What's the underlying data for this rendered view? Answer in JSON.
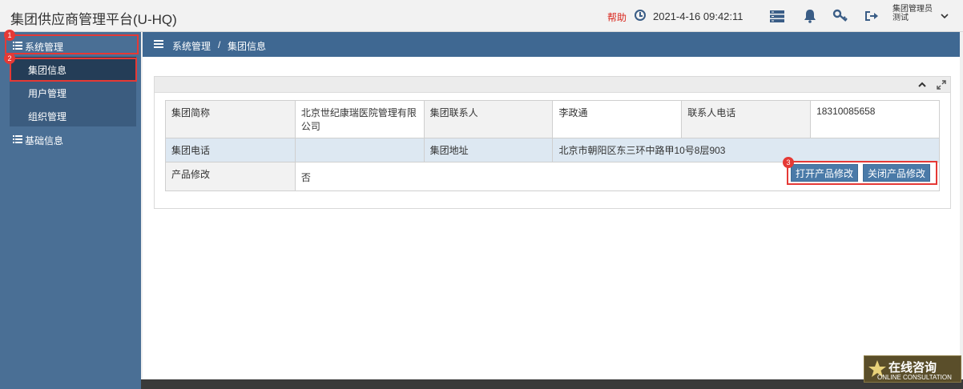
{
  "header": {
    "app_title": "集团供应商管理平台(U-HQ)",
    "help_label": "帮助",
    "datetime": "2021-4-16  09:42:11",
    "user_name_line1": "集团管理员",
    "user_name_line2": "测试",
    "icons": [
      "clock-icon",
      "server-icon",
      "bell-icon",
      "key-icon",
      "logout-icon",
      "chevron-down-icon"
    ]
  },
  "sidebar": {
    "system_mgmt": "系统管理",
    "sub_items": [
      {
        "label": "集团信息"
      },
      {
        "label": "用户管理"
      },
      {
        "label": "组织管理"
      }
    ],
    "basic_info": "基础信息"
  },
  "breadcrumb": {
    "level1": "系统管理",
    "separator": "/",
    "level2": "集团信息"
  },
  "info": {
    "rows": [
      {
        "k1": "集团简称",
        "v1": "北京世纪康瑞医院管理有限公司",
        "k2": "集团联系人",
        "v2": "李政通",
        "k3": "联系人电话",
        "v3": "18310085658"
      },
      {
        "k1": "集团电话",
        "v1": "",
        "k2": "集团地址",
        "v2": "北京市朝阳区东三环中路甲10号8层903"
      },
      {
        "k1": "产品修改",
        "v1": "否"
      }
    ]
  },
  "actions": {
    "open_product_edit": "打开产品修改",
    "close_product_edit": "关闭产品修改"
  },
  "annotations": {
    "badge1": "1",
    "badge2": "2",
    "badge3": "3"
  },
  "consult": {
    "title": "在线咨询",
    "subtitle": "ONLINE CONSULTATION"
  },
  "colors": {
    "sidebar": "#4a6f95",
    "breadcrumb_bar": "#3f6892",
    "highlight_red": "#e53935",
    "help_red": "#d9281e",
    "button": "#4a7aa8"
  }
}
